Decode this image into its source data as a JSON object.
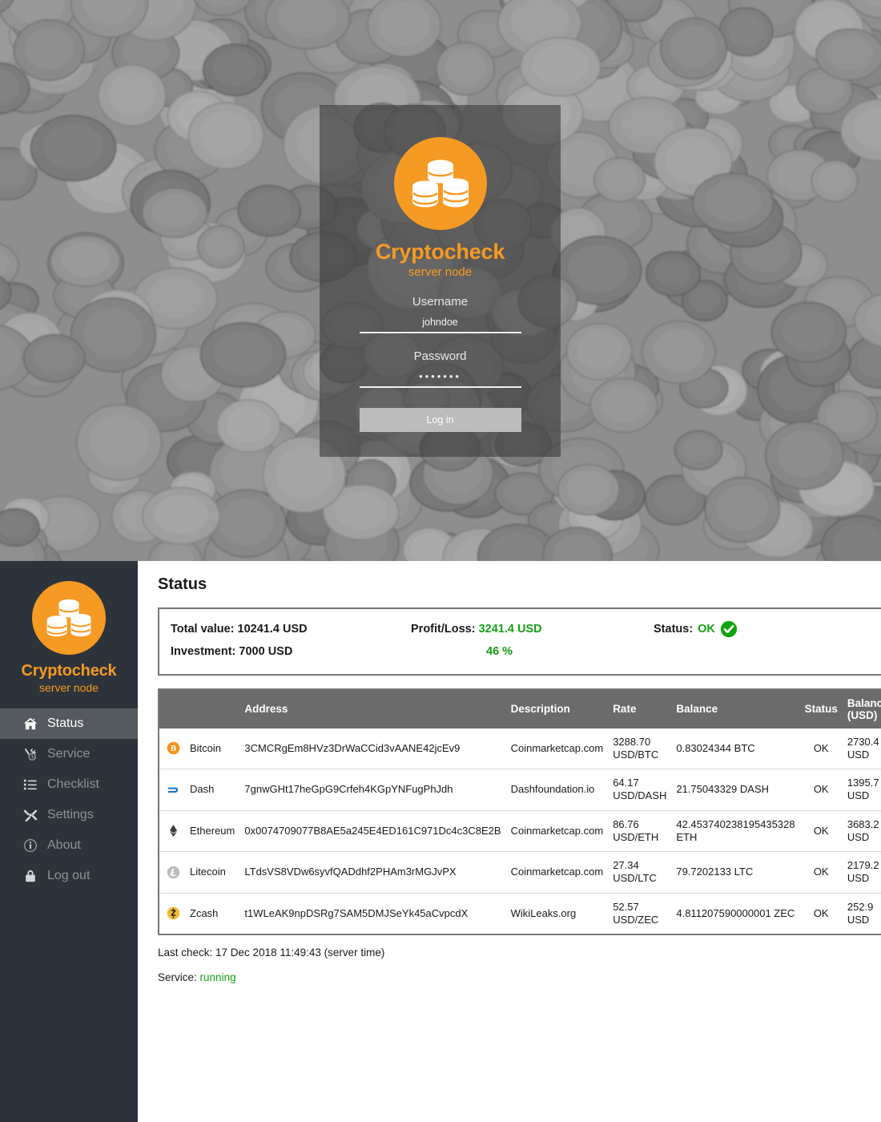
{
  "login": {
    "brand_name": "Cryptocheck",
    "brand_sub": "server node",
    "logo_icon": "coin-stacks-icon",
    "username_label": "Username",
    "username_value": "johndoe",
    "username_placeholder": "Username",
    "password_label": "Password",
    "password_value": "•••••••",
    "password_placeholder": "Password",
    "submit_label": "Log in"
  },
  "sidebar": {
    "brand_name": "Cryptocheck",
    "brand_sub": "server node",
    "logo_icon": "coin-stacks-icon",
    "items": [
      {
        "label": "Status",
        "icon": "home-icon",
        "active": true
      },
      {
        "label": "Service",
        "icon": "tools-icon",
        "active": false
      },
      {
        "label": "Checklist",
        "icon": "list-icon",
        "active": false
      },
      {
        "label": "Settings",
        "icon": "wrench-icon",
        "active": false
      },
      {
        "label": "About",
        "icon": "info-icon",
        "active": false
      },
      {
        "label": "Log out",
        "icon": "lock-icon",
        "active": false
      }
    ]
  },
  "main": {
    "page_title": "Status",
    "summary": {
      "total_value_label": "Total value:",
      "total_value": "10241.4 USD",
      "investment_label": "Investment:",
      "investment": "7000 USD",
      "profit_loss_label": "Profit/Loss:",
      "profit_loss": "3241.4 USD",
      "profit_pct": "46 %",
      "status_label": "Status:",
      "status_value": "OK",
      "status_icon": "green-check-icon"
    },
    "table": {
      "headers": {
        "icon": "",
        "name": "",
        "address": "Address",
        "description": "Description",
        "rate": "Rate",
        "balance": "Balance",
        "status": "Status",
        "balance_usd": "Balance (USD)"
      },
      "rows": [
        {
          "icon": "bitcoin-icon",
          "name": "Bitcoin",
          "address": "3CMCRgEm8HVz3DrWaCCid3vAANE42jcEv9",
          "description": "Coinmarketcap.com",
          "rate": "3288.70 USD/BTC",
          "balance": "0.83024344 BTC",
          "status": "OK",
          "balance_usd": "2730.4 USD"
        },
        {
          "icon": "dash-icon",
          "name": "Dash",
          "address": "7gnwGHt17heGpG9Crfeh4KGpYNFugPhJdh",
          "description": "Dashfoundation.io",
          "rate": "64.17 USD/DASH",
          "balance": "21.75043329 DASH",
          "status": "OK",
          "balance_usd": "1395.7 USD"
        },
        {
          "icon": "ethereum-icon",
          "name": "Ethereum",
          "address": "0x0074709077B8AE5a245E4ED161C971Dc4c3C8E2B",
          "description": "Coinmarketcap.com",
          "rate": "86.76 USD/ETH",
          "balance": "42.453740238195435328 ETH",
          "status": "OK",
          "balance_usd": "3683.2 USD"
        },
        {
          "icon": "litecoin-icon",
          "name": "Litecoin",
          "address": "LTdsVS8VDw6syvfQADdhf2PHAm3rMGJvPX",
          "description": "Coinmarketcap.com",
          "rate": "27.34 USD/LTC",
          "balance": "79.7202133 LTC",
          "status": "OK",
          "balance_usd": "2179.2 USD"
        },
        {
          "icon": "zcash-icon",
          "name": "Zcash",
          "address": "t1WLeAK9npDSRg7SAM5DMJSeYk45aCvpcdX",
          "description": "WikiLeaks.org",
          "rate": "52.57 USD/ZEC",
          "balance": "4.811207590000001 ZEC",
          "status": "OK",
          "balance_usd": "252.9 USD"
        }
      ]
    },
    "last_check": "Last check: 17 Dec 2018 11:49:43 (server time)",
    "service_label": "Service:",
    "service_value": "running"
  },
  "colors": {
    "brand_orange": "#f59a23",
    "sidebar_bg": "#2d333b",
    "status_green": "#14a014",
    "table_header": "#6b6b6b"
  }
}
